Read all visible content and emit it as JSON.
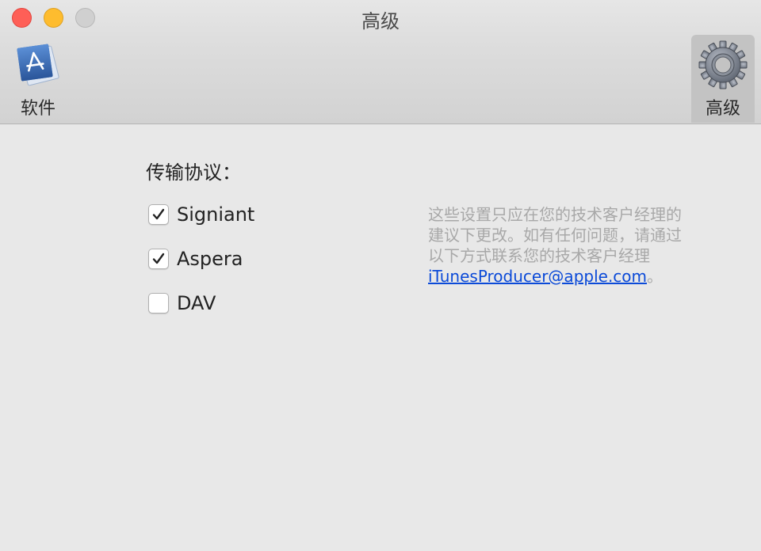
{
  "window": {
    "title": "高级"
  },
  "toolbar": {
    "items": [
      {
        "label": "软件",
        "icon": "app-store-icon",
        "selected": false
      },
      {
        "label": "高级",
        "icon": "gear-icon",
        "selected": true
      }
    ]
  },
  "transfer": {
    "heading": "传输协议：",
    "protocols": [
      {
        "label": "Signiant",
        "checked": true
      },
      {
        "label": "Aspera",
        "checked": true
      },
      {
        "label": "DAV",
        "checked": false
      }
    ]
  },
  "info": {
    "text": "这些设置只应在您的技术客户经理的建议下更改。如有任何问题，请通过以下方式联系您的技术客户经理",
    "email": "iTunesProducer@apple.com",
    "suffix": "。"
  },
  "colors": {
    "link": "#0b4ad8",
    "close": "#fe5f57",
    "minimize": "#febc2e",
    "zoom_disabled": "#d0d0d0"
  }
}
